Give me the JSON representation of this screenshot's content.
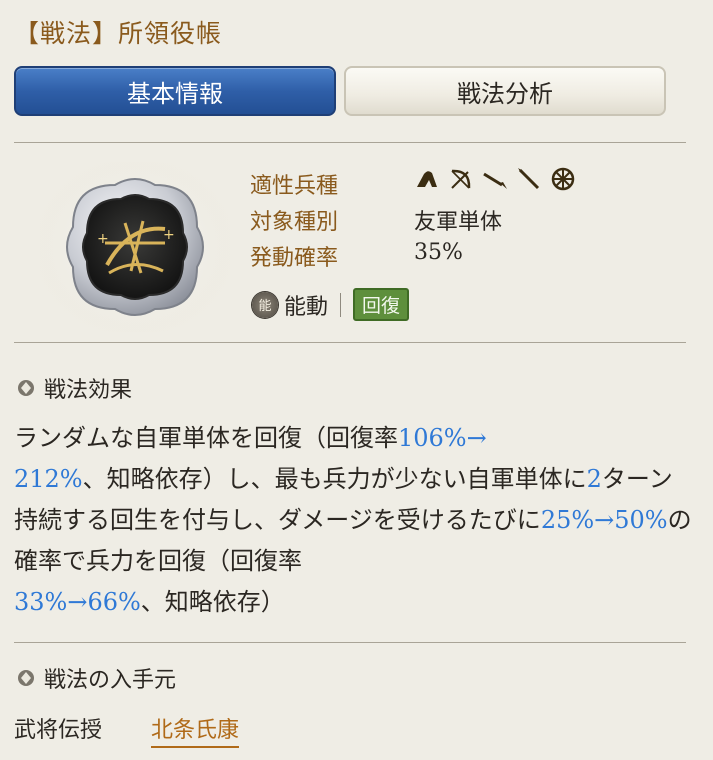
{
  "header": {
    "title": "【戦法】所領役帳"
  },
  "tabs": [
    {
      "label": "基本情報",
      "active": true
    },
    {
      "label": "戦法分析",
      "active": false
    }
  ],
  "info": {
    "unit_label": "適性兵種",
    "unit_icons": [
      "cavalry-icon",
      "bow-icon",
      "spear-icon",
      "rifle-icon",
      "shield-icon"
    ],
    "target_label": "対象種別",
    "target_value": "友軍単体",
    "rate_label": "発動確率",
    "rate_value": "35%"
  },
  "tags": {
    "type_icon_text": "能",
    "type_label": "能動",
    "category": "回復"
  },
  "effect": {
    "heading": "戦法効果",
    "t1": "ランダムな自軍単体を回復（回復率",
    "h1": "106%→",
    "h2": "212%",
    "t2": "、知略依存）し、最も兵力が少ない自軍単体に",
    "h3": "2",
    "t3": "ターン持続する回生を付与し、ダメージを受けるたびに",
    "h4": "25%→50%",
    "t4": "の確率で兵力を回復（回復率",
    "h5": "33%→66%",
    "t5": "、知略依存）"
  },
  "source": {
    "heading": "戦法の入手元",
    "method": "武将伝授",
    "general": "北条氏康"
  },
  "colors": {
    "accent": "#8a5a1d",
    "highlight": "#2f79d6",
    "tab_active": "#2f5fa8",
    "badge": "#5e8f3c",
    "link": "#b06a18"
  }
}
